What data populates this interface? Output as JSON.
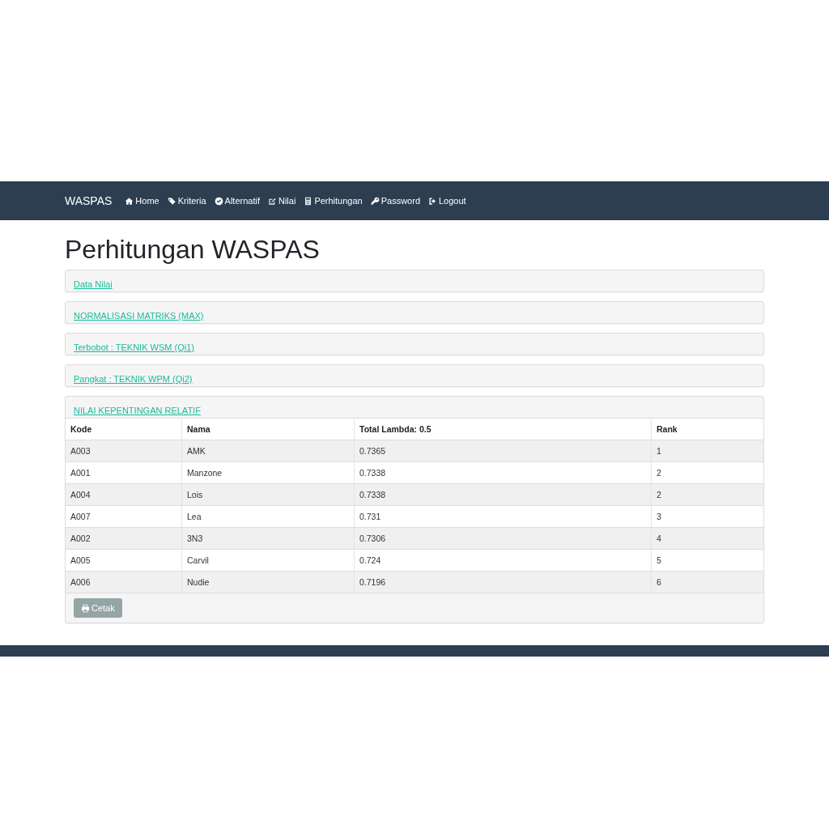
{
  "navbar": {
    "brand": "WASPAS",
    "items": [
      {
        "label": "Home"
      },
      {
        "label": "Kriteria"
      },
      {
        "label": "Alternatif"
      },
      {
        "label": "Nilai"
      },
      {
        "label": "Perhitungan"
      },
      {
        "label": "Password"
      },
      {
        "label": "Logout"
      }
    ]
  },
  "page_title": "Perhitungan WASPAS",
  "panels": [
    {
      "title": "Data Nilai",
      "expanded": false
    },
    {
      "title": "NORMALISASI MATRIKS (MAX)",
      "expanded": false
    },
    {
      "title": "Terbobot : TEKNIK WSM (Qi1)",
      "expanded": false
    },
    {
      "title": "Pangkat : TEKNIK WPM (Qi2)",
      "expanded": false
    },
    {
      "title": "NILAI KEPENTINGAN RELATIF",
      "expanded": true
    }
  ],
  "table": {
    "columns": [
      "Kode",
      "Nama",
      "Total Lambda: 0.5",
      "Rank"
    ],
    "rows": [
      [
        "A003",
        "AMK",
        "0.7365",
        "1"
      ],
      [
        "A001",
        "Manzone",
        "0.7338",
        "2"
      ],
      [
        "A004",
        "Lois",
        "0.7338",
        "2"
      ],
      [
        "A007",
        "Lea",
        "0.731",
        "3"
      ],
      [
        "A002",
        "3N3",
        "0.7306",
        "4"
      ],
      [
        "A005",
        "Carvil",
        "0.724",
        "5"
      ],
      [
        "A006",
        "Nudie",
        "0.7196",
        "6"
      ]
    ]
  },
  "print_button": {
    "label": "Cetak"
  }
}
